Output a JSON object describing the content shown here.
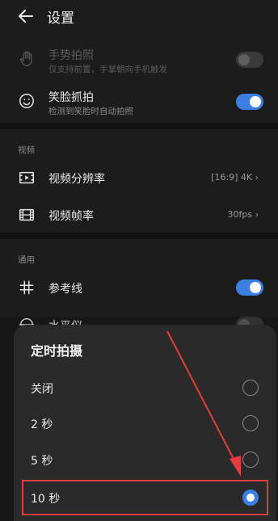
{
  "header": {
    "title": "设置"
  },
  "rows": {
    "gesture": {
      "main": "手势拍照",
      "sub": "仅支持前置，手掌朝向手机触发"
    },
    "smile": {
      "main": "笑脸抓拍",
      "sub": "检测到笑脸时自动拍照"
    },
    "resolution": {
      "main": "视频分辨率",
      "value": "[16:9] 4K"
    },
    "framerate": {
      "main": "视频帧率",
      "value": "30fps"
    },
    "gridline": {
      "main": "参考线"
    },
    "level": {
      "main": "水平仪"
    }
  },
  "sections": {
    "video": "视频",
    "general": "通用"
  },
  "toggles": {
    "gesture": false,
    "smile": true,
    "gridline": true,
    "level": false
  },
  "timer_sheet": {
    "title": "定时拍摄",
    "options": [
      {
        "label": "关闭",
        "selected": false
      },
      {
        "label": "2 秒",
        "selected": false
      },
      {
        "label": "5 秒",
        "selected": false
      },
      {
        "label": "10 秒",
        "selected": true
      }
    ]
  },
  "colors": {
    "accent": "#3d7fe0",
    "annotation": "#e53d3d",
    "background": "#1c1c1c",
    "sheet": "#2a2a2b"
  },
  "icons": [
    "back-arrow-icon",
    "hand-icon",
    "smile-icon",
    "video-resolution-icon",
    "film-icon",
    "grid-icon",
    "level-icon",
    "chevron-right-icon"
  ]
}
